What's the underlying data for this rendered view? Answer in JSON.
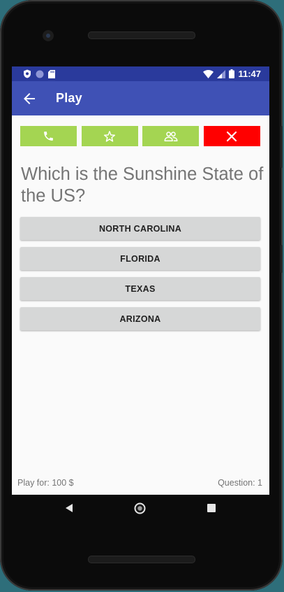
{
  "status_bar": {
    "time": "11:47",
    "left_icons": [
      "vpn-shield-icon",
      "circle-notification-icon",
      "sd-card-icon"
    ],
    "right_icons": [
      "wifi-icon",
      "cell-signal-icon",
      "battery-icon"
    ]
  },
  "app_bar": {
    "title": "Play",
    "back_icon": "arrow-back-icon"
  },
  "lifelines": [
    {
      "icon": "phone-icon",
      "color": "#a4d552"
    },
    {
      "icon": "star-icon",
      "color": "#a4d552"
    },
    {
      "icon": "people-icon",
      "color": "#a4d552"
    },
    {
      "icon": "close-icon",
      "color": "#ff0000"
    }
  ],
  "question": "Which is the Sunshine State of the US?",
  "answers": [
    "NORTH CAROLINA",
    "FLORIDA",
    "TEXAS",
    "ARIZONA"
  ],
  "footer": {
    "play_for": "Play for: 100 $",
    "question_number": "Question: 1"
  },
  "colors": {
    "status_bar": "#2a3a9c",
    "app_bar": "#3f51b5",
    "lifeline_green": "#a4d552",
    "lifeline_red": "#ff0000",
    "answer_bg": "#d6d7d7"
  }
}
